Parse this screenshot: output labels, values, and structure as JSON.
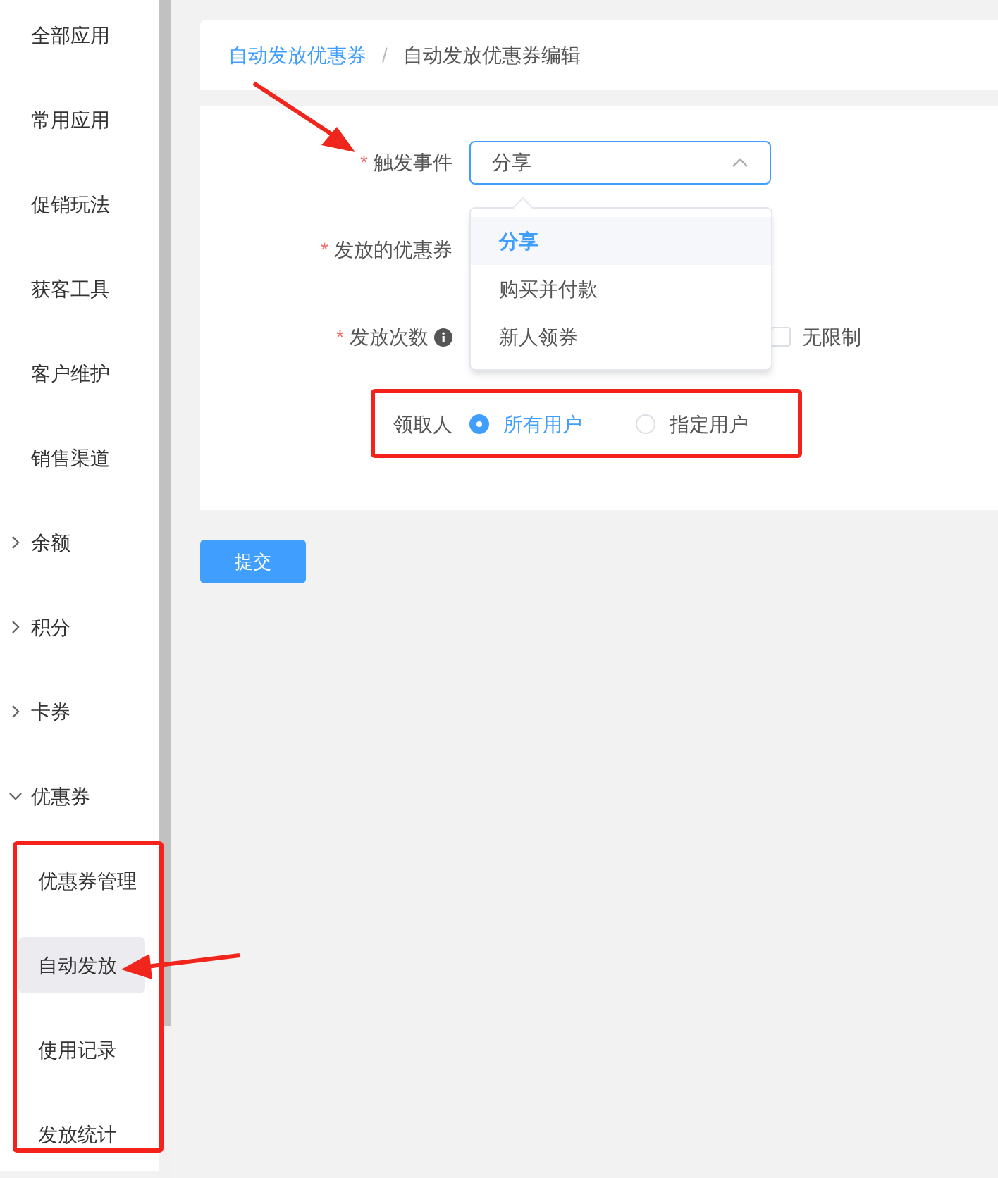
{
  "sidebar": {
    "items": [
      {
        "label": "全部应用",
        "kind": "item"
      },
      {
        "label": "常用应用",
        "kind": "item"
      },
      {
        "label": "促销玩法",
        "kind": "item"
      },
      {
        "label": "获客工具",
        "kind": "item"
      },
      {
        "label": "客户维护",
        "kind": "item"
      },
      {
        "label": "销售渠道",
        "kind": "item"
      },
      {
        "label": "余额",
        "kind": "group",
        "expanded": false
      },
      {
        "label": "积分",
        "kind": "group",
        "expanded": false
      },
      {
        "label": "卡券",
        "kind": "group",
        "expanded": false
      },
      {
        "label": "优惠券",
        "kind": "group",
        "expanded": true,
        "children": [
          {
            "label": "优惠券管理",
            "selected": false
          },
          {
            "label": "自动发放",
            "selected": true
          },
          {
            "label": "使用记录",
            "selected": false
          },
          {
            "label": "发放统计",
            "selected": false
          }
        ]
      }
    ]
  },
  "breadcrumb": [
    {
      "label": "自动发放优惠券",
      "kind": "link"
    },
    {
      "label": "自动发放优惠券编辑",
      "kind": "current"
    }
  ],
  "breadcrumb_separator": "/",
  "form": {
    "trigger": {
      "label": "触发事件",
      "required_mark": "*",
      "value": "分享",
      "open": true,
      "options": [
        {
          "label": "分享",
          "selected": true
        },
        {
          "label": "购买并付款",
          "selected": false
        },
        {
          "label": "新人领券",
          "selected": false
        }
      ]
    },
    "coupon": {
      "label": "发放的优惠券",
      "required_mark": "*"
    },
    "times": {
      "label": "发放次数",
      "required_mark": "*",
      "unlimited_label": "无限制",
      "unlimited": false
    },
    "recipient": {
      "label": "领取人",
      "options": [
        {
          "label": "所有用户",
          "selected": true
        },
        {
          "label": "指定用户",
          "selected": false
        }
      ]
    }
  },
  "submit": "提交"
}
